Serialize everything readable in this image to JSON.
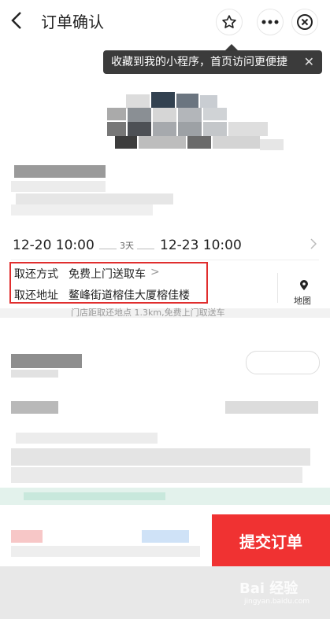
{
  "header": {
    "back_icon": "chevron-left-icon",
    "title": "订单确认",
    "star_icon": "star-icon",
    "more_icon": "more-icon",
    "close_icon": "close-circle-icon"
  },
  "tooltip": {
    "text": "收藏到我的小程序，首页访问更便捷",
    "close": "✕"
  },
  "rental": {
    "pickup_datetime": "12-20 10:00",
    "duration": "3天",
    "return_datetime": "12-23 10:00",
    "method_label": "取还方式",
    "method_value": "免费上门送取车",
    "method_chevron": ">",
    "address_label": "取还地址",
    "address_value": "鳌峰街道榕佳大厦榕佳楼",
    "map_label": "地图",
    "note": "门店距取还地点 1.3km,免费上门取送车"
  },
  "bottom": {
    "submit_label": "提交订单"
  },
  "watermark": {
    "text": "Bai 经验",
    "sub": "jingyan.baidu.com"
  },
  "colors": {
    "accent": "#f03232",
    "highlight_box": "#e02e2e"
  }
}
